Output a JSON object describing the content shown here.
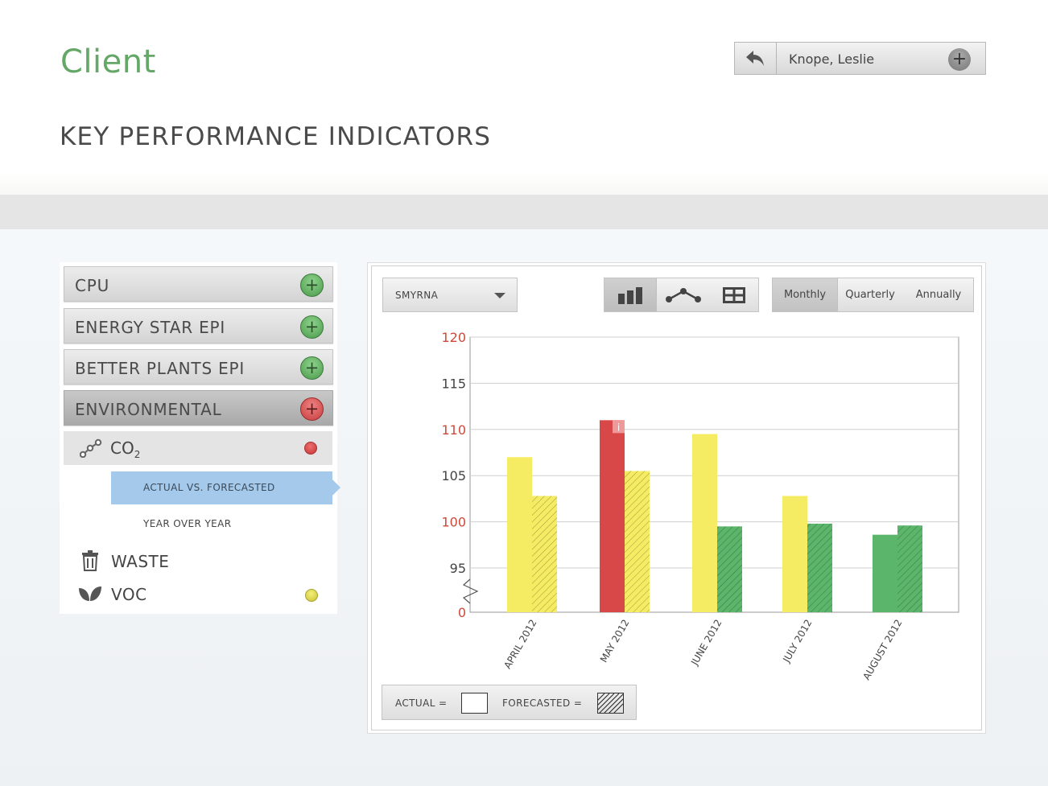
{
  "header": {
    "title": "Client",
    "section_title": "KEY PERFORMANCE INDICATORS",
    "user": {
      "name": "Knope, Leslie"
    }
  },
  "sidebar": {
    "categories": [
      {
        "label": "CPU",
        "state": "green"
      },
      {
        "label": "ENERGY STAR EPI",
        "state": "green"
      },
      {
        "label": "BETTER PLANTS EPI",
        "state": "green"
      },
      {
        "label": "ENVIRONMENTAL",
        "state": "red"
      }
    ],
    "co2": {
      "label": "CO",
      "subscript": "2",
      "status_color": "#d24545"
    },
    "co2_views": [
      {
        "label": "ACTUAL VS. FORECASTED",
        "selected": true
      },
      {
        "label": "YEAR OVER YEAR",
        "selected": false
      }
    ],
    "waste": {
      "label": "WASTE"
    },
    "voc": {
      "label": "VOC",
      "status_color": "#e2de4a"
    }
  },
  "toolbar": {
    "site_select": "SMYRNA",
    "view_types": [
      {
        "icon": "bar-chart-icon",
        "selected": true
      },
      {
        "icon": "line-chart-icon",
        "selected": false
      },
      {
        "icon": "table-grid-icon",
        "selected": false
      }
    ],
    "periods": [
      "Monthly",
      "Quarterly",
      "Annually"
    ],
    "selected_period": "Monthly"
  },
  "legend": {
    "actual_label": "ACTUAL =",
    "forecast_label": "FORECASTED ="
  },
  "colors": {
    "yellow": "#f5ec63",
    "red": "#d94848",
    "green": "#5bb56a",
    "axis_red": "#cc4a3a",
    "axis_dark": "#444444",
    "accent_green": "#64a766"
  },
  "chart_data": {
    "type": "bar",
    "categories": [
      "APRIL 2012",
      "MAY 2012",
      "JUNE 2012",
      "JULY 2012",
      "AUGUST 2012"
    ],
    "series": [
      {
        "name": "ACTUAL",
        "values": [
          107,
          111,
          109.5,
          102.8,
          98.6
        ],
        "colors": [
          "#f5ec63",
          "#d94848",
          "#f5ec63",
          "#f5ec63",
          "#5bb56a"
        ]
      },
      {
        "name": "FORECASTED",
        "values": [
          102.8,
          105.5,
          99.5,
          99.8,
          99.6
        ],
        "colors": [
          "#f5ec63",
          "#f5ec63",
          "#5bb56a",
          "#5bb56a",
          "#5bb56a"
        ]
      }
    ],
    "y_ticks": [
      {
        "value": 120,
        "label": "120",
        "color": "#cc4a3a"
      },
      {
        "value": 115,
        "label": "115",
        "color": "#444444"
      },
      {
        "value": 110,
        "label": "110",
        "color": "#cc4a3a"
      },
      {
        "value": 105,
        "label": "105",
        "color": "#444444"
      },
      {
        "value": 100,
        "label": "100",
        "color": "#cc4a3a"
      },
      {
        "value": 95,
        "label": "95",
        "color": "#444444"
      },
      {
        "value": 0,
        "label": "0",
        "color": "#cc4a3a"
      }
    ],
    "axis_break": true,
    "ylim": [
      93,
      120
    ],
    "info_marker": {
      "category": "MAY 2012",
      "label": "i"
    },
    "grid": true,
    "title": "",
    "xlabel": "",
    "ylabel": ""
  }
}
